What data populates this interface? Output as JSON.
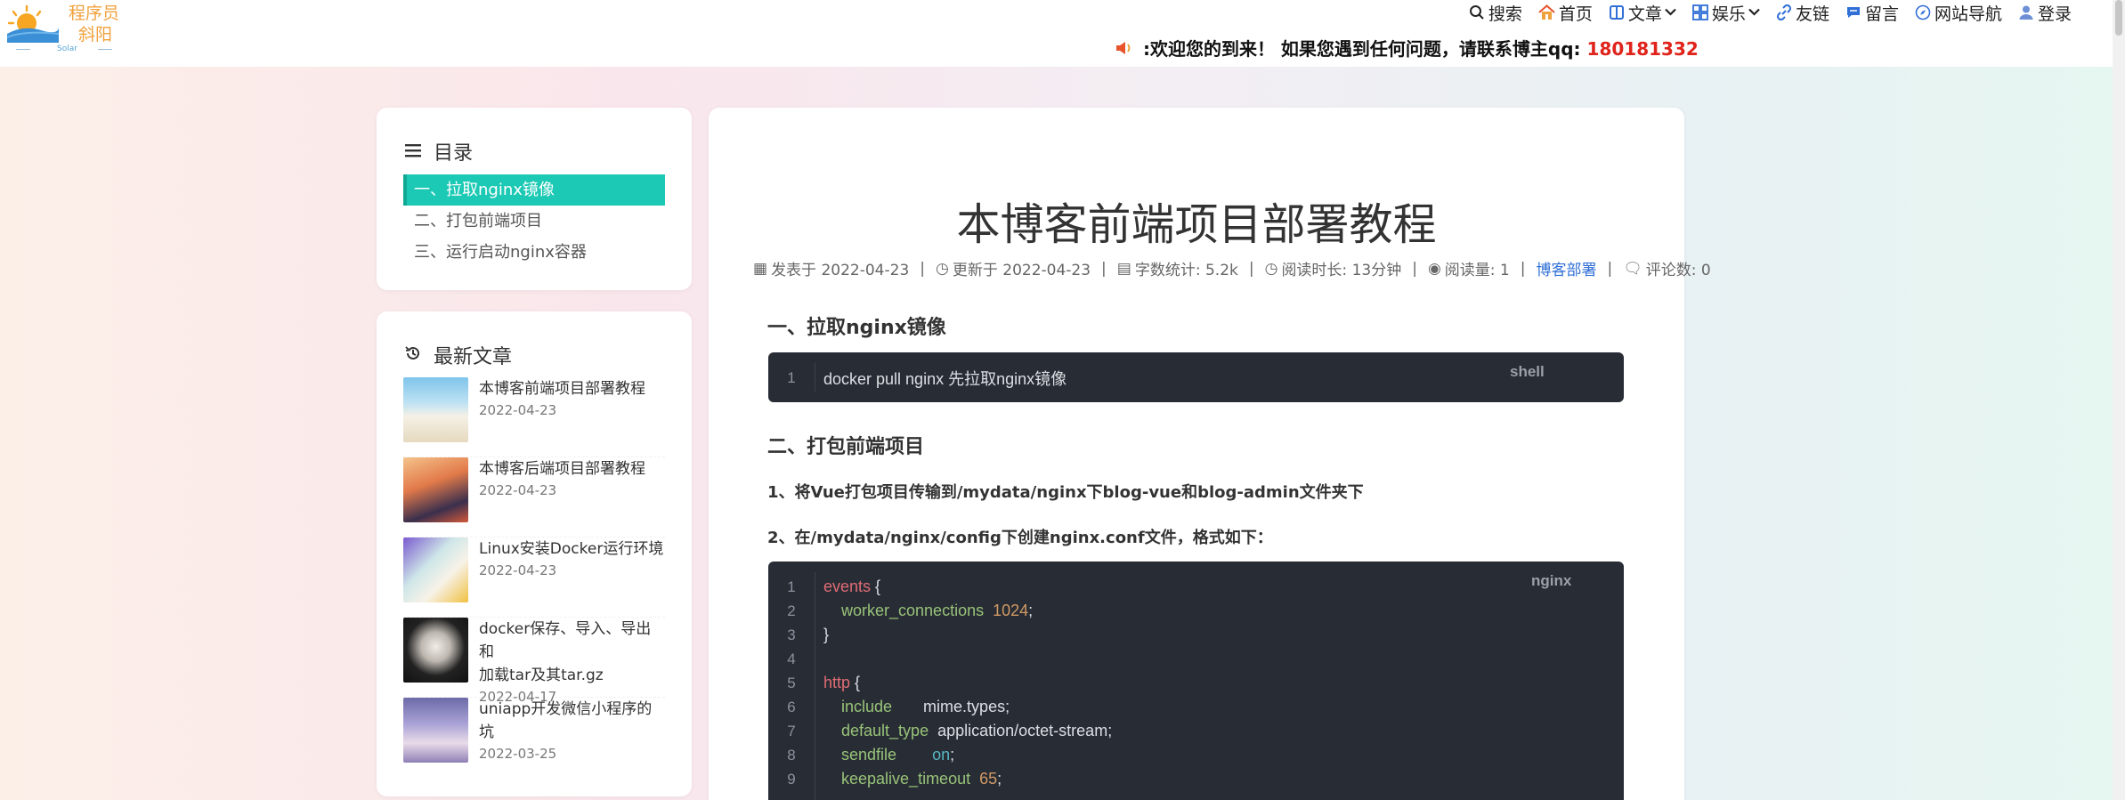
{
  "header": {
    "brand_line1": "程序员",
    "brand_line2": "斜阳",
    "brand_sub": "Solar",
    "nav": [
      {
        "label": "搜索",
        "icon": "search-icon"
      },
      {
        "label": "首页",
        "icon": "home-icon"
      },
      {
        "label": "文章",
        "icon": "book-icon",
        "caret": "⌄"
      },
      {
        "label": "娱乐",
        "icon": "grid-icon",
        "caret": "⌄"
      },
      {
        "label": "友链",
        "icon": "link-icon"
      },
      {
        "label": "留言",
        "icon": "message-icon"
      },
      {
        "label": "网站导航",
        "icon": "compass-icon"
      },
      {
        "label": "登录",
        "icon": "user-icon"
      }
    ],
    "notice_text": ":欢迎您的到来！ 如果您遇到任何问题，请联系博主qq: ",
    "notice_qq": "180181332",
    "notice_icon": "speaker-icon"
  },
  "toc": {
    "title": "目录",
    "items": [
      "一、拉取nginx镜像",
      "二、打包前端项目",
      "三、运行启动nginx容器"
    ]
  },
  "latest": {
    "title": "最新文章",
    "items": [
      {
        "title": "本博客前端项目部署教程",
        "date": "2022-04-23"
      },
      {
        "title": "本博客后端项目部署教程",
        "date": "2022-04-23"
      },
      {
        "title": "Linux安装Docker运行环境",
        "date": "2022-04-23"
      },
      {
        "title": "docker保存、导入、导出和",
        "title2": "加载tar及其tar.gz",
        "date": "2022-04-17"
      },
      {
        "title": "uniapp开发微信小程序的坑",
        "date": "2022-03-25"
      }
    ]
  },
  "post": {
    "title": "本博客前端项目部署教程",
    "meta": {
      "published": "发表于 2022-04-23",
      "updated": "更新于 2022-04-23",
      "words": "字数统计: 5.2k",
      "read_time": "阅读时长: 13分钟",
      "views": "阅读量: 1",
      "category": "博客部署",
      "comments": "评论数: 0",
      "sep": "|"
    },
    "h1": "一、拉取nginx镜像",
    "code1": {
      "lang": "shell",
      "line": "1",
      "text": "docker pull nginx 先拉取nginx镜像"
    },
    "h2": "二、打包前端项目",
    "p1": "1、将Vue打包项目传输到/mydata/nginx下blog-vue和blog-admin文件夹下",
    "p2": "2、在/mydata/nginx/config下创建nginx.conf文件，格式如下：",
    "code2": {
      "lang": "nginx",
      "lines": [
        {
          "n": "1",
          "a": "events",
          "b": " {",
          "c": "",
          "d": ""
        },
        {
          "n": "2",
          "a": "    worker_connections",
          "b": "  ",
          "c": "1024",
          "d": ";"
        },
        {
          "n": "3",
          "a": "",
          "b": "}",
          "c": "",
          "d": ""
        },
        {
          "n": "4",
          "a": "",
          "b": "",
          "c": "",
          "d": ""
        },
        {
          "n": "5",
          "a": "http",
          "b": " {",
          "c": "",
          "d": ""
        },
        {
          "n": "6",
          "a": "    include",
          "b": "       mime.types;",
          "c": "",
          "d": ""
        },
        {
          "n": "7",
          "a": "    default_type",
          "b": "  application/octet-stream;",
          "c": "",
          "d": ""
        },
        {
          "n": "8",
          "a": "    sendfile",
          "b": "        ",
          "c": "on",
          "d": ";"
        },
        {
          "n": "9",
          "a": "    keepalive_timeout",
          "b": "  ",
          "c": "65",
          "d": ";"
        }
      ]
    }
  }
}
